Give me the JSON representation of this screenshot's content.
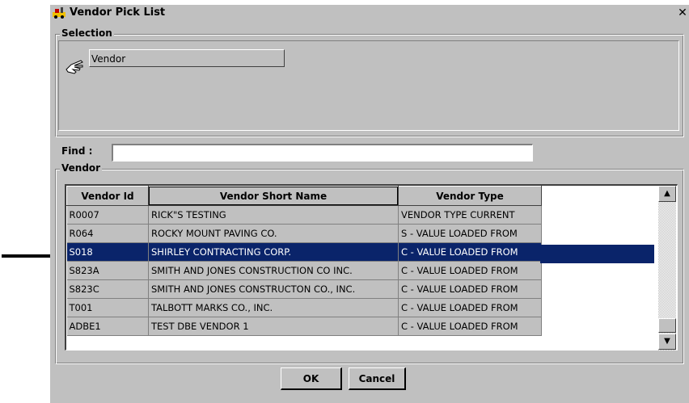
{
  "window": {
    "title": "Vendor Pick List",
    "close_glyph": "✕"
  },
  "selection": {
    "label": "Selection",
    "field_value": "Vendor"
  },
  "find": {
    "label": "Find :",
    "value": ""
  },
  "vendor_group": {
    "label": "Vendor"
  },
  "grid": {
    "columns": [
      "Vendor Id",
      "Vendor Short Name",
      "Vendor Type"
    ],
    "rows": [
      {
        "id": "R0007",
        "name": "RICK\"S TESTING",
        "type": "VENDOR TYPE CURRENT"
      },
      {
        "id": "R064",
        "name": "ROCKY MOUNT PAVING CO.",
        "type": "S - VALUE LOADED FROM"
      },
      {
        "id": "S018",
        "name": "SHIRLEY CONTRACTING CORP.",
        "type": "C - VALUE LOADED FROM"
      },
      {
        "id": "S823A",
        "name": "SMITH AND JONES CONSTRUCTION CO INC.",
        "type": "C - VALUE LOADED FROM"
      },
      {
        "id": "S823C",
        "name": "SMITH AND JONES CONSTRUCTON CO., INC.",
        "type": "C - VALUE LOADED FROM"
      },
      {
        "id": "T001",
        "name": "TALBOTT MARKS CO., INC.",
        "type": "C - VALUE LOADED FROM"
      },
      {
        "id": "ADBE1",
        "name": "TEST DBE VENDOR 1",
        "type": "C - VALUE LOADED FROM"
      }
    ],
    "selected_index": 2
  },
  "buttons": {
    "ok": "OK",
    "cancel": "Cancel"
  },
  "colors": {
    "selection": "#0a246a",
    "face": "#c0c0c0"
  }
}
